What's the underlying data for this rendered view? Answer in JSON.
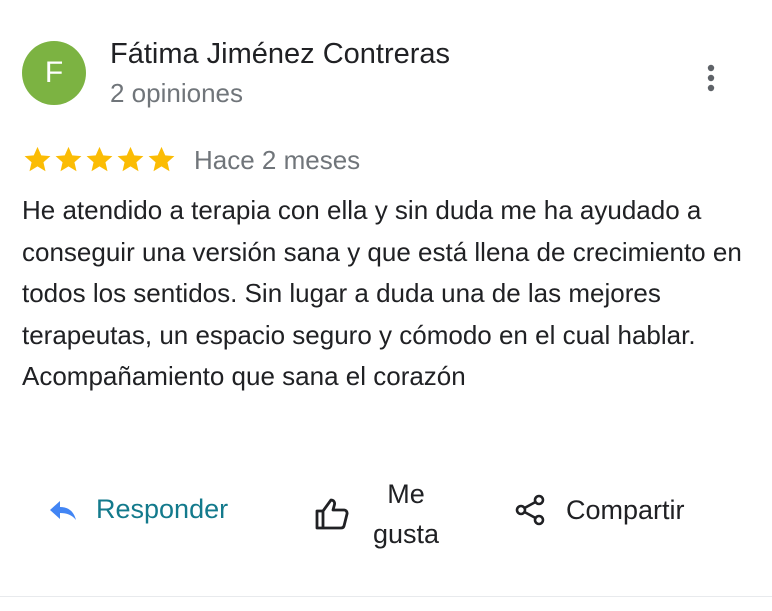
{
  "reviewer": {
    "initial": "F",
    "name": "Fátima Jiménez Contreras",
    "review_count": "2 opiniones",
    "avatar_color": "#7cb342"
  },
  "review": {
    "rating": 5,
    "max_rating": 5,
    "star_color": "#fbbc04",
    "date": "Hace 2 meses",
    "text": "He atendido a terapia con ella y sin duda me ha ayudado a conseguir una versión sana y que está llena de crecimiento en todos los sentidos. Sin lugar a duda una de las mejores terapeutas, un espacio seguro y cómodo en el cual hablar. Acompañamiento que sana el corazón"
  },
  "actions": {
    "reply_label": "Responder",
    "like_label": "Me gusta",
    "share_label": "Compartir",
    "more_icon": "more-vert-icon"
  }
}
